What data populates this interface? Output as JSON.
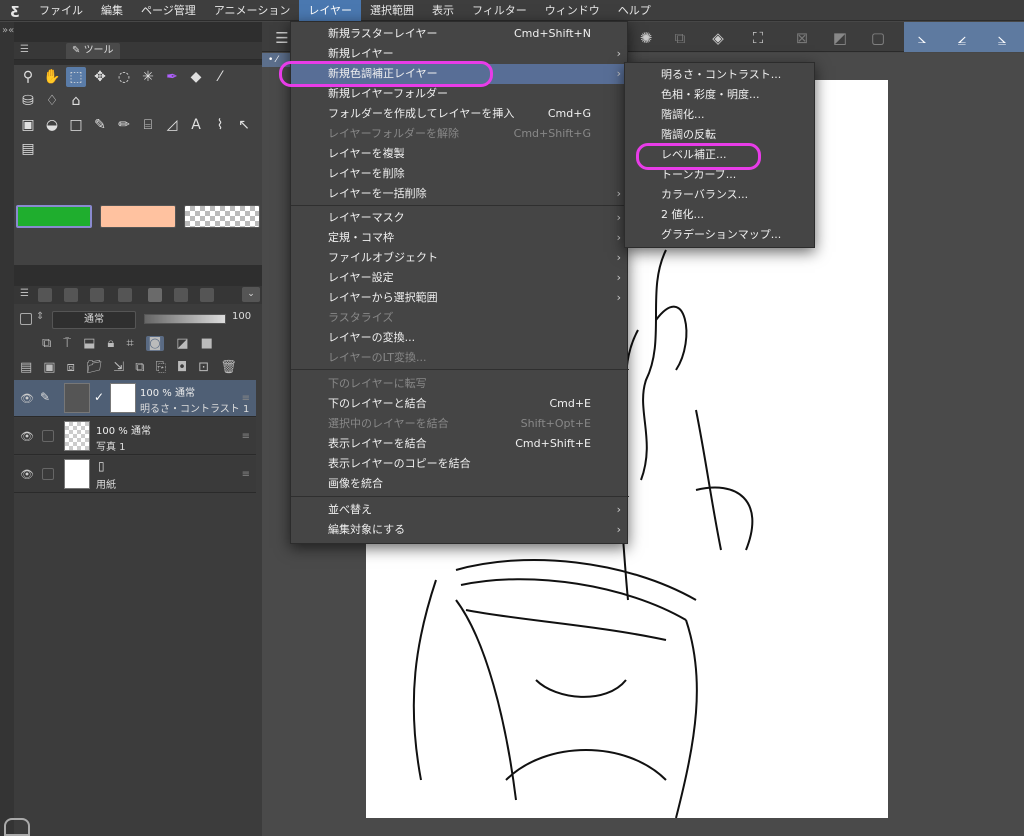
{
  "menubar": {
    "logo": "ƹ",
    "items": [
      "ファイル",
      "編集",
      "ページ管理",
      "アニメーション",
      "レイヤー",
      "選択範囲",
      "表示",
      "フィルター",
      "ウィンドウ",
      "ヘルプ"
    ],
    "active_index": 4
  },
  "tool_panel": {
    "tab_label": "ツール"
  },
  "colors": {
    "main": "#1fae2e",
    "sub": "#ffc2a0",
    "accent": "#586e96",
    "highlight_ring": "#e83ce8"
  },
  "layer_panel": {
    "blend_mode": "通常",
    "opacity": "100",
    "layers": [
      {
        "line1": "100 % 通常",
        "line2": "明るさ・コントラスト 1",
        "active": true
      },
      {
        "line1": "100 % 通常",
        "line2": "写真 1",
        "active": false
      },
      {
        "line1": "",
        "line2": "用紙",
        "active": false
      }
    ]
  },
  "layer_menu": {
    "items": [
      {
        "label": "新規ラスターレイヤー",
        "shortcut": "Cmd+Shift+N",
        "arrow": "",
        "disabled": false
      },
      {
        "label": "新規レイヤー",
        "shortcut": "",
        "arrow": "›",
        "disabled": false
      },
      {
        "label": "新規色調補正レイヤー",
        "shortcut": "",
        "arrow": "›",
        "disabled": false
      },
      {
        "label": "新規レイヤーフォルダー",
        "shortcut": "",
        "arrow": "",
        "disabled": false
      },
      {
        "label": "フォルダーを作成してレイヤーを挿入",
        "shortcut": "Cmd+G",
        "arrow": "",
        "disabled": false
      },
      {
        "label": "レイヤーフォルダーを解除",
        "shortcut": "Cmd+Shift+G",
        "arrow": "",
        "disabled": true
      },
      {
        "label": "レイヤーを複製",
        "shortcut": "",
        "arrow": "",
        "disabled": false
      },
      {
        "label": "レイヤーを削除",
        "shortcut": "",
        "arrow": "",
        "disabled": false
      },
      {
        "label": "レイヤーを一括削除",
        "shortcut": "",
        "arrow": "›",
        "disabled": false
      },
      {
        "label": "レイヤーマスク",
        "shortcut": "",
        "arrow": "›",
        "disabled": false
      },
      {
        "label": "定規・コマ枠",
        "shortcut": "",
        "arrow": "›",
        "disabled": false
      },
      {
        "label": "ファイルオブジェクト",
        "shortcut": "",
        "arrow": "›",
        "disabled": false
      },
      {
        "label": "レイヤー設定",
        "shortcut": "",
        "arrow": "›",
        "disabled": false
      },
      {
        "label": "レイヤーから選択範囲",
        "shortcut": "",
        "arrow": "›",
        "disabled": false
      },
      {
        "label": "ラスタライズ",
        "shortcut": "",
        "arrow": "",
        "disabled": true
      },
      {
        "label": "レイヤーの変換...",
        "shortcut": "",
        "arrow": "",
        "disabled": false
      },
      {
        "label": "レイヤーのLT変換...",
        "shortcut": "",
        "arrow": "",
        "disabled": true
      },
      {
        "label": "下のレイヤーに転写",
        "shortcut": "",
        "arrow": "",
        "disabled": true
      },
      {
        "label": "下のレイヤーと結合",
        "shortcut": "Cmd+E",
        "arrow": "",
        "disabled": false
      },
      {
        "label": "選択中のレイヤーを結合",
        "shortcut": "Shift+Opt+E",
        "arrow": "",
        "disabled": true
      },
      {
        "label": "表示レイヤーを結合",
        "shortcut": "Cmd+Shift+E",
        "arrow": "",
        "disabled": false
      },
      {
        "label": "表示レイヤーのコピーを結合",
        "shortcut": "",
        "arrow": "",
        "disabled": false
      },
      {
        "label": "画像を統合",
        "shortcut": "",
        "arrow": "",
        "disabled": false
      },
      {
        "label": "並べ替え",
        "shortcut": "",
        "arrow": "›",
        "disabled": false
      },
      {
        "label": "編集対象にする",
        "shortcut": "",
        "arrow": "›",
        "disabled": false
      }
    ]
  },
  "adjust_submenu": {
    "items": [
      "明るさ・コントラスト...",
      "色相・彩度・明度...",
      "階調化...",
      "階調の反転",
      "レベル補正...",
      "トーンカーブ...",
      "カラーバランス...",
      "2 値化...",
      "グラデーションマップ..."
    ]
  }
}
